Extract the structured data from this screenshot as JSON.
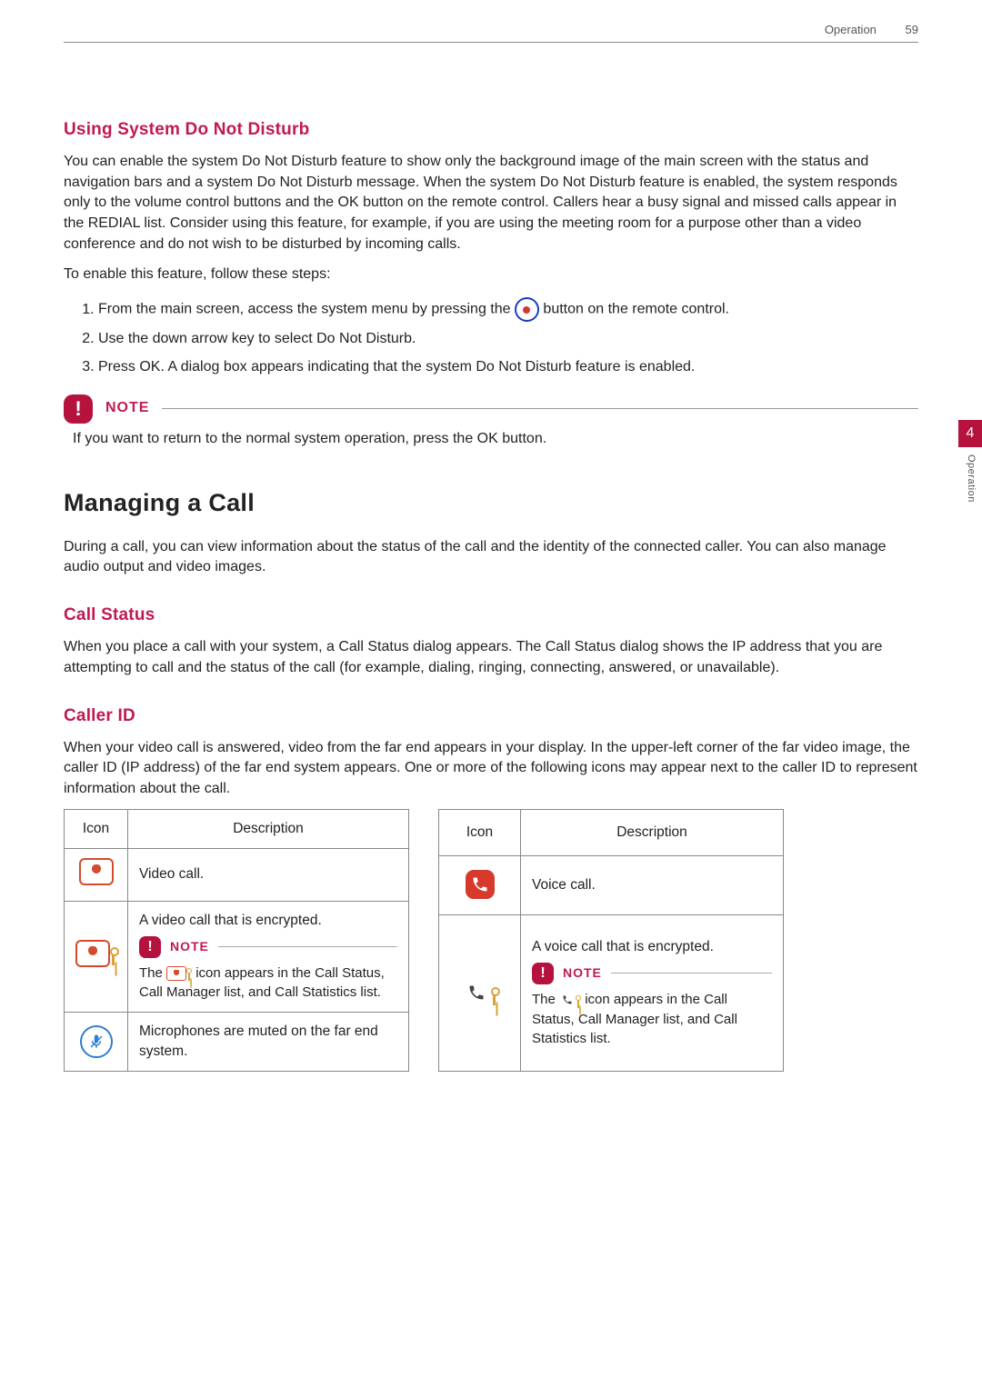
{
  "header": {
    "section": "Operation",
    "page": "59"
  },
  "side_tab": {
    "number": "4",
    "label": "Operation"
  },
  "h_using_dnd": "Using System Do Not Disturb",
  "p_dnd_intro": "You can enable the system Do Not Disturb feature to show only the background image of the main screen with the status and navigation bars and a system Do Not Disturb message. When the system Do Not Disturb feature is enabled, the system responds only to the volume control buttons and the OK button on the remote control. Callers hear a busy signal and missed calls appear in the REDIAL list. Consider using this feature, for example, if you are using the meeting room for a purpose other than a video conference and do not wish to be disturbed by incoming calls.",
  "p_dnd_steps_intro": "To enable this feature, follow these steps:",
  "step1_a": "From the main screen, access the system menu by pressing the ",
  "step1_b": " button on the remote control.",
  "step2": "Use the down arrow key to select Do Not Disturb.",
  "step3": "Press OK. A dialog box appears indicating that the system Do Not Disturb feature is enabled.",
  "note_label": "NOTE",
  "note_dnd_body": "If you want to return to the normal system operation, press the OK button.",
  "h_managing": "Managing a Call",
  "p_managing": "During a call, you can view information about the status of the call and the identity of the connected caller. You can also manage audio output and video images.",
  "h_call_status": "Call Status",
  "p_call_status": "When you place a call with your system, a Call Status dialog appears. The Call Status dialog shows the IP address that you are attempting to call and the status of the call (for example, dialing, ringing, connecting, answered, or unavailable).",
  "h_caller_id": "Caller ID",
  "p_caller_id": "When your video call is answered, video from the far end appears in your display. In the upper-left corner of the far video image, the caller ID (IP address) of the far end system appears. One or more of the following icons may appear next to the caller ID to represent information about the call.",
  "thead_icon": "Icon",
  "thead_desc": "Description",
  "leftTable": {
    "r1": "Video call.",
    "r2a": "A video call that is encrypted.",
    "r2note_a": "The ",
    "r2note_b": " icon appears in the Call Status, Call Manager list, and Call Statistics list.",
    "r3": "Microphones are muted on the far end system."
  },
  "rightTable": {
    "r1": "Voice call.",
    "r2a": "A voice call that is encrypted.",
    "r2note_a": "The ",
    "r2note_b": " icon appears in the Call Status, Call Manager list, and Call Statistics list."
  }
}
